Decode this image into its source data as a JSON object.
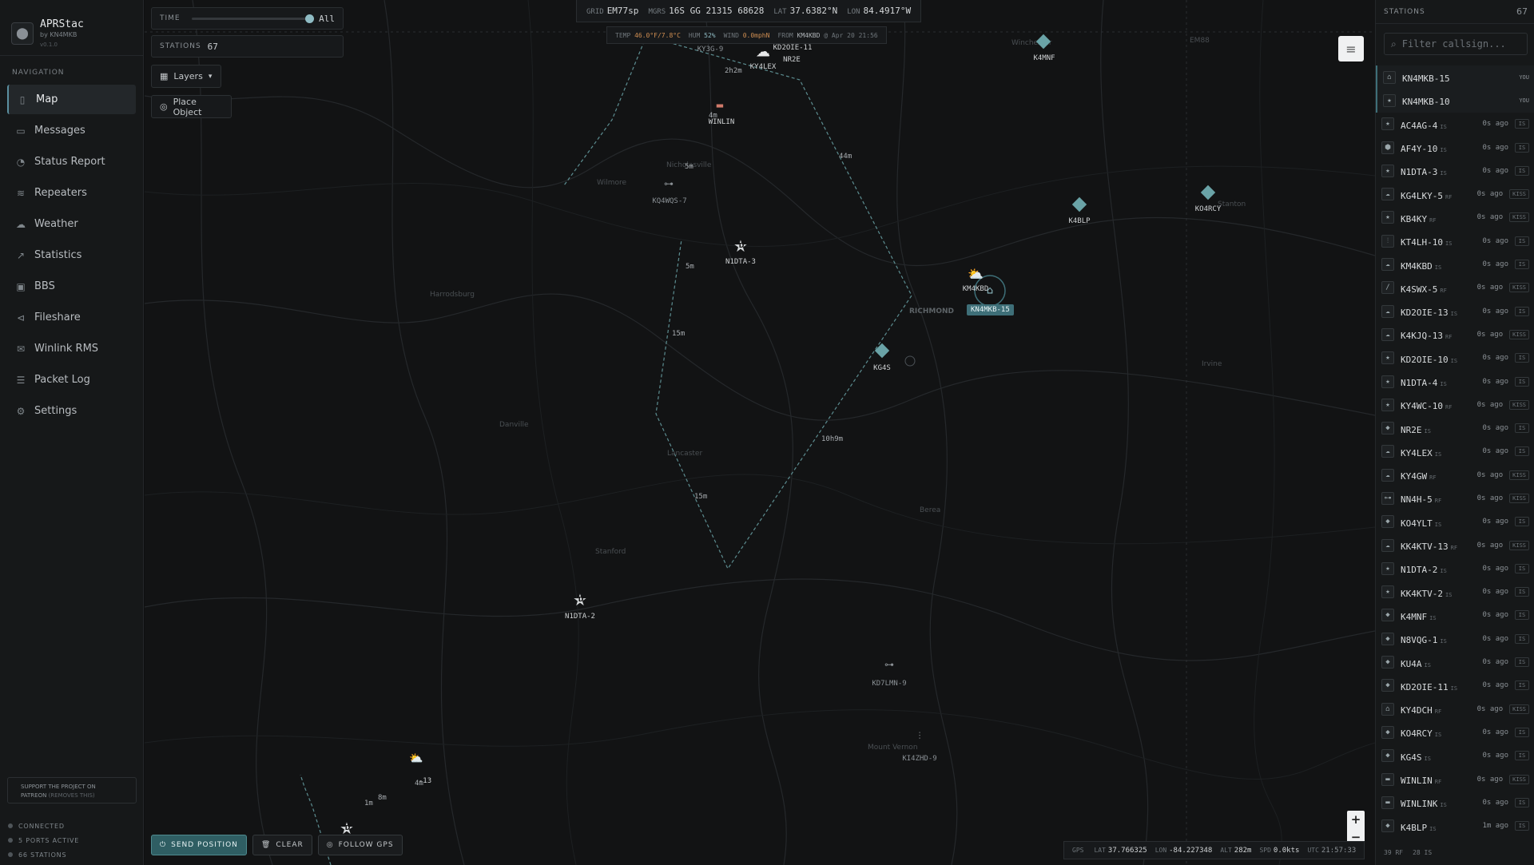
{
  "brand": {
    "title": "APRStac",
    "subtitle": "by KN4MKB",
    "version": "v0.1.0"
  },
  "nav": {
    "heading": "NAVIGATION",
    "items": [
      {
        "label": "Map",
        "icon": "map-icon",
        "glyph": "▯"
      },
      {
        "label": "Messages",
        "icon": "message-icon",
        "glyph": "▭"
      },
      {
        "label": "Status Report",
        "icon": "status-check-icon",
        "glyph": "◔"
      },
      {
        "label": "Repeaters",
        "icon": "antenna-waves-icon",
        "glyph": "≋"
      },
      {
        "label": "Weather",
        "icon": "cloud-icon",
        "glyph": "☁"
      },
      {
        "label": "Statistics",
        "icon": "chart-line-icon",
        "glyph": "↗"
      },
      {
        "label": "BBS",
        "icon": "terminal-icon",
        "glyph": "▣"
      },
      {
        "label": "Fileshare",
        "icon": "share-icon",
        "glyph": "⊲"
      },
      {
        "label": "Winlink RMS",
        "icon": "mail-icon",
        "glyph": "✉"
      },
      {
        "label": "Packet Log",
        "icon": "list-icon",
        "glyph": "☰"
      },
      {
        "label": "Settings",
        "icon": "gear-icon",
        "glyph": "⚙"
      }
    ]
  },
  "patreon": {
    "line1": "SUPPORT THE PROJECT ON",
    "line2": "PATREON",
    "line3": "(REMOVES THIS)"
  },
  "status": {
    "connected": "CONNECTED",
    "ports": "5 PORTS ACTIVE",
    "stations": "66 STATIONS"
  },
  "map": {
    "time_label": "TIME",
    "time_value": "All",
    "stations_label": "STATIONS",
    "stations_value": "67",
    "layers_label": "Layers",
    "place_label": "Place Object",
    "top_status": {
      "grid_k": "GRID",
      "grid": "EM77sp",
      "mgrs_k": "MGRS",
      "mgrs": "16S GG 21315 68628",
      "lat_k": "LAT",
      "lat": "37.6382°N",
      "lon_k": "LON",
      "lon": "84.4917°W"
    },
    "weather": {
      "temp_k": "TEMP",
      "temp": "46.0°F/7.8°C",
      "hum_k": "HUM",
      "hum": "52%",
      "wind_k": "WIND",
      "wind": "0.0mphN",
      "from_k": "FROM",
      "from": "KM4KBD",
      "date": "@ Apr 20 21:56"
    },
    "buttons": {
      "send": "SEND POSITION",
      "clear": "CLEAR",
      "follow": "FOLLOW GPS"
    },
    "gps": {
      "gps_k": "GPS",
      "lat_k": "LAT",
      "lat": "37.766325",
      "lon_k": "LON",
      "lon": "-84.227348",
      "alt_k": "ALT",
      "alt": "282m",
      "spd_k": "SPD",
      "spd": "0.0kts",
      "utc_k": "UTC",
      "utc": "21:57:33"
    },
    "zoom_in": "+",
    "zoom_out": "−",
    "towns": [
      "Harrodsburg",
      "Danville",
      "Lancaster",
      "Stanford",
      "Wilmore",
      "Nicholasville",
      "RICHMOND",
      "Berea",
      "Irvine",
      "Stanton",
      "Winchester",
      "Mount Vernon",
      "EM88"
    ],
    "segments": [
      "2h2m",
      "4m",
      "5m",
      "5m",
      "15m",
      "15m",
      "44m",
      "10h9m",
      "1m",
      "8m",
      "4m"
    ],
    "stations": [
      "KY4LEX",
      "KD2OIE-11",
      "NR2E",
      "K4MNF",
      "KY3G-9",
      "WINLIN",
      "KQ4WQS-7",
      "N1DTA-3",
      "K4BLP",
      "KO4RCY",
      "KM4KBD",
      "KN4MKB-15",
      "KG4S",
      "N1DTA-2",
      "KD7LMN-9",
      "KI4ZHD-9",
      "-13"
    ]
  },
  "rightbar": {
    "heading": "STATIONS",
    "count": "67",
    "filter_placeholder": "Filter callsign...",
    "stations": [
      {
        "call": "KN4MKB-15",
        "src": "",
        "ago": "",
        "tag": "YOU",
        "icon": "house-icon",
        "glyph": "⌂"
      },
      {
        "call": "KN4MKB-10",
        "src": "",
        "ago": "",
        "tag": "YOU",
        "icon": "star-icon",
        "glyph": "★"
      },
      {
        "call": "AC4AG-4",
        "src": "IS",
        "ago": "0s ago",
        "tag": "IS",
        "icon": "star-icon",
        "glyph": "★"
      },
      {
        "call": "AF4Y-10",
        "src": "IS",
        "ago": "0s ago",
        "tag": "IS",
        "icon": "shield-icon",
        "glyph": "⬢"
      },
      {
        "call": "N1DTA-3",
        "src": "IS",
        "ago": "0s ago",
        "tag": "IS",
        "icon": "star-icon",
        "glyph": "★"
      },
      {
        "call": "KG4LKY-5",
        "src": "RF",
        "ago": "0s ago",
        "tag": "KISS",
        "icon": "weather-icon",
        "glyph": "☁"
      },
      {
        "call": "KB4KY",
        "src": "RF",
        "ago": "0s ago",
        "tag": "KISS",
        "icon": "star-icon",
        "glyph": "★"
      },
      {
        "call": "KT4LH-10",
        "src": "IS",
        "ago": "0s ago",
        "tag": "IS",
        "icon": "tower-icon",
        "glyph": "⫶"
      },
      {
        "call": "KM4KBD",
        "src": "IS",
        "ago": "0s ago",
        "tag": "IS",
        "icon": "weather-icon",
        "glyph": "☁"
      },
      {
        "call": "K4SWX-5",
        "src": "RF",
        "ago": "0s ago",
        "tag": "KISS",
        "icon": "slash-icon",
        "glyph": "/"
      },
      {
        "call": "KD2OIE-13",
        "src": "IS",
        "ago": "0s ago",
        "tag": "IS",
        "icon": "weather-icon",
        "glyph": "☁"
      },
      {
        "call": "K4KJQ-13",
        "src": "RF",
        "ago": "0s ago",
        "tag": "KISS",
        "icon": "weather-icon",
        "glyph": "☁"
      },
      {
        "call": "KD2OIE-10",
        "src": "IS",
        "ago": "0s ago",
        "tag": "IS",
        "icon": "star-icon",
        "glyph": "★"
      },
      {
        "call": "N1DTA-4",
        "src": "IS",
        "ago": "0s ago",
        "tag": "IS",
        "icon": "star-icon",
        "glyph": "★"
      },
      {
        "call": "KY4WC-10",
        "src": "RF",
        "ago": "0s ago",
        "tag": "KISS",
        "icon": "star-icon",
        "glyph": "★"
      },
      {
        "call": "NR2E",
        "src": "IS",
        "ago": "0s ago",
        "tag": "IS",
        "icon": "diamond-icon",
        "glyph": "◆"
      },
      {
        "call": "KY4LEX",
        "src": "IS",
        "ago": "0s ago",
        "tag": "IS",
        "icon": "weather-icon",
        "glyph": "☁"
      },
      {
        "call": "KY4GW",
        "src": "RF",
        "ago": "0s ago",
        "tag": "KISS",
        "icon": "weather-icon",
        "glyph": "☁"
      },
      {
        "call": "NN4H-5",
        "src": "RF",
        "ago": "0s ago",
        "tag": "KISS",
        "icon": "car-icon",
        "glyph": "⊶"
      },
      {
        "call": "KO4YLT",
        "src": "IS",
        "ago": "0s ago",
        "tag": "IS",
        "icon": "diamond-icon",
        "glyph": "◆"
      },
      {
        "call": "KK4KTV-13",
        "src": "RF",
        "ago": "0s ago",
        "tag": "KISS",
        "icon": "weather-icon",
        "glyph": "☁"
      },
      {
        "call": "N1DTA-2",
        "src": "IS",
        "ago": "0s ago",
        "tag": "IS",
        "icon": "star-icon",
        "glyph": "★"
      },
      {
        "call": "KK4KTV-2",
        "src": "IS",
        "ago": "0s ago",
        "tag": "IS",
        "icon": "star-icon",
        "glyph": "★"
      },
      {
        "call": "K4MNF",
        "src": "IS",
        "ago": "0s ago",
        "tag": "IS",
        "icon": "diamond-icon",
        "glyph": "◆"
      },
      {
        "call": "N8VQG-1",
        "src": "IS",
        "ago": "0s ago",
        "tag": "IS",
        "icon": "diamond-icon",
        "glyph": "◆"
      },
      {
        "call": "KU4A",
        "src": "IS",
        "ago": "0s ago",
        "tag": "IS",
        "icon": "diamond-icon",
        "glyph": "◆"
      },
      {
        "call": "KD2OIE-11",
        "src": "IS",
        "ago": "0s ago",
        "tag": "IS",
        "icon": "diamond-icon",
        "glyph": "◆"
      },
      {
        "call": "KY4DCH",
        "src": "RF",
        "ago": "0s ago",
        "tag": "KISS",
        "icon": "house-icon",
        "glyph": "⌂"
      },
      {
        "call": "KO4RCY",
        "src": "IS",
        "ago": "0s ago",
        "tag": "IS",
        "icon": "diamond-icon",
        "glyph": "◆"
      },
      {
        "call": "KG4S",
        "src": "IS",
        "ago": "0s ago",
        "tag": "IS",
        "icon": "diamond-icon",
        "glyph": "◆"
      },
      {
        "call": "WINLIN",
        "src": "RF",
        "ago": "0s ago",
        "tag": "KISS",
        "icon": "winlink-icon",
        "glyph": "▬"
      },
      {
        "call": "WINLINK",
        "src": "IS",
        "ago": "0s ago",
        "tag": "IS",
        "icon": "winlink-icon",
        "glyph": "▬"
      },
      {
        "call": "K4BLP",
        "src": "IS",
        "ago": "1m ago",
        "tag": "IS",
        "icon": "diamond-icon",
        "glyph": "◆"
      }
    ],
    "footer": {
      "rf": "39 RF",
      "is": "28 IS"
    }
  },
  "colors": {
    "accent": "#3e6f78",
    "diamond": "#6aa3a7",
    "bg": "#121314"
  }
}
